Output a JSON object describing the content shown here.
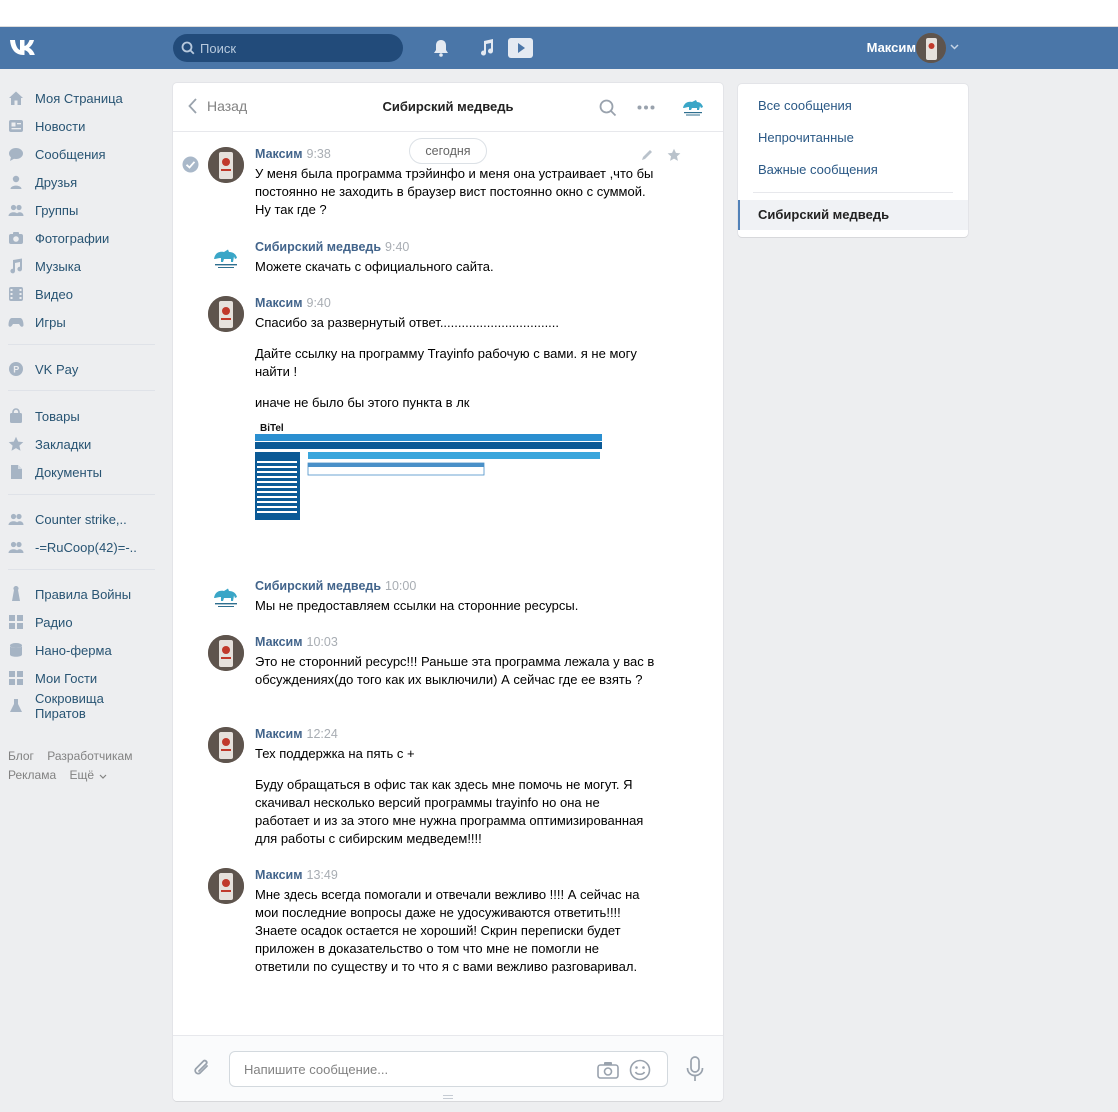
{
  "header": {
    "logo_icon": "vk-logo-icon",
    "search_placeholder": "Поиск",
    "user_name": "Максим",
    "icons": [
      "bell-icon",
      "music-icon",
      "video-play-icon",
      "chevron-down-icon"
    ]
  },
  "sidebar": {
    "items": [
      {
        "label": "Моя Страница",
        "icon": "home-icon"
      },
      {
        "label": "Новости",
        "icon": "news-icon"
      },
      {
        "label": "Сообщения",
        "icon": "messages-icon"
      },
      {
        "label": "Друзья",
        "icon": "friends-icon"
      },
      {
        "label": "Группы",
        "icon": "groups-icon"
      },
      {
        "label": "Фотографии",
        "icon": "camera-icon"
      },
      {
        "label": "Музыка",
        "icon": "music-icon"
      },
      {
        "label": "Видео",
        "icon": "video-icon"
      },
      {
        "label": "Игры",
        "icon": "gamepad-icon"
      },
      {
        "label": "VK Pay",
        "icon": "vkpay-icon"
      },
      {
        "label": "Товары",
        "icon": "bag-icon"
      },
      {
        "label": "Закладки",
        "icon": "star-icon"
      },
      {
        "label": "Документы",
        "icon": "document-icon"
      },
      {
        "label": "Counter strike,..",
        "icon": "group-icon"
      },
      {
        "label": "-=RuCoop(42)=-..",
        "icon": "group-icon"
      },
      {
        "label": "Правила Войны",
        "icon": "app-icon"
      },
      {
        "label": "Радио",
        "icon": "app-icon"
      },
      {
        "label": "Нано-ферма",
        "icon": "app-icon"
      },
      {
        "label": "Мои Гости",
        "icon": "app-icon"
      },
      {
        "label": "Сокровища Пиратов",
        "icon": "app-icon"
      }
    ],
    "footer": {
      "blog": "Блог",
      "developers": "Разработчикам",
      "ads": "Реклама",
      "more": "Ещё"
    }
  },
  "chat": {
    "back_label": "Назад",
    "title": "Сибирский медведь",
    "date_divider": "сегодня",
    "messages": [
      {
        "author": "Максим",
        "time": "9:38",
        "paragraphs": [
          "У меня была программа трэйинфо и меня она устраивает ,что бы постоянно не заходить в браузер вист постоянно окно с суммой. Ну так где ?"
        ]
      },
      {
        "author": "Сибирский медведь",
        "time": "9:40",
        "paragraphs": [
          "Можете скачать с официального сайта."
        ]
      },
      {
        "author": "Максим",
        "time": "9:40",
        "paragraphs": [
          "Спасибо за развернутый ответ.................................",
          "Дайте ссылку на программу Trayinfo рабочую с вами. я не могу найти !",
          "иначе не было бы этого пункта в лк"
        ]
      },
      {
        "author": "Сибирский медведь",
        "time": "10:00",
        "paragraphs": [
          "Мы не предоставляем ссылки на сторонние ресурсы."
        ]
      },
      {
        "author": "Максим",
        "time": "10:03",
        "paragraphs": [
          "Это не сторонний ресурс!!! Раньше эта программа лежала у вас в обсуждениях(до того как их выключили) А сейчас где ее взять ?"
        ]
      },
      {
        "author": "Максим",
        "time": "12:24",
        "paragraphs": [
          "Тех поддержка на пять с +",
          "Буду обращаться в офис так как здесь мне помочь не могут. Я скачивал несколько версий программы trayinfo но она не работает и из за этого мне нужна программа оптимизированная для работы с сибирским медведем!!!!"
        ]
      },
      {
        "author": "Максим",
        "time": "13:49",
        "paragraphs": [
          "Мне здесь всегда помогали и отвечали вежливо !!!! А сейчас на мои последние вопросы даже не удосуживаются ответить!!!! Знаете осадок остается не хороший! Скрин переписки будет приложен в доказательство о том что мне не помогли не ответили по существу и то что я с вами вежливо разговаривал."
        ]
      }
    ],
    "attachment": {
      "brand_text": "BiTel"
    },
    "composer_placeholder": "Напишите сообщение..."
  },
  "right_panel": {
    "items": [
      "Все сообщения",
      "Непрочитанные",
      "Важные сообщения"
    ],
    "active": "Сибирский медведь"
  },
  "colors": {
    "header_bg": "#4a76a8",
    "link": "#2a5885",
    "author": "#42648b",
    "page_bg": "#edeef0"
  }
}
